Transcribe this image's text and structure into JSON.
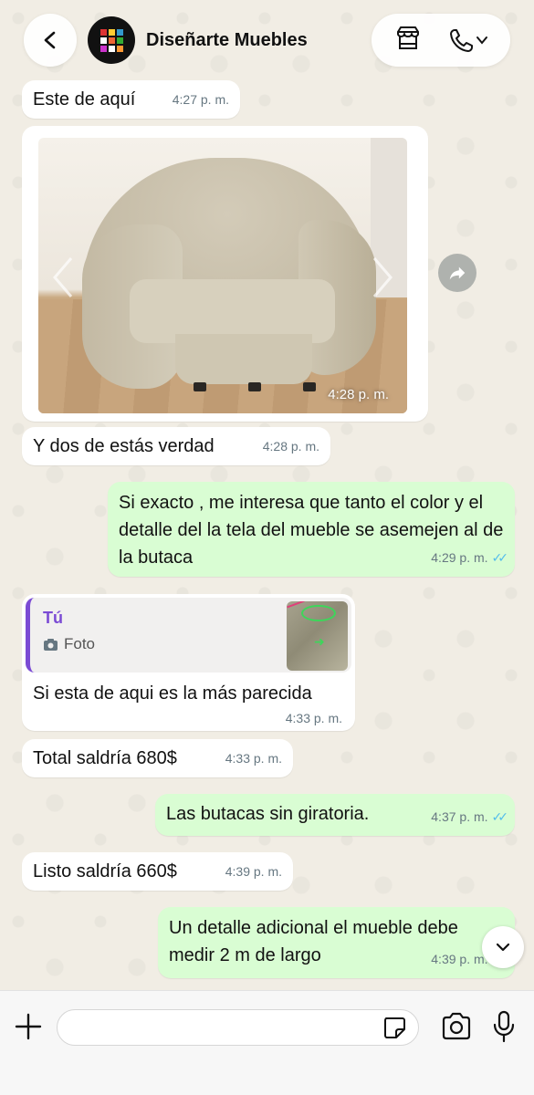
{
  "header": {
    "contact_name": "Diseñarte Muebles"
  },
  "messages": [
    {
      "direction": "in",
      "text": "Este de aquí",
      "time": "4:27 p. m."
    },
    {
      "direction": "in",
      "type": "image",
      "time": "4:28 p. m."
    },
    {
      "direction": "in",
      "text": "Y dos de estás verdad",
      "time": "4:28 p. m."
    },
    {
      "direction": "out",
      "text": "Si exacto ,  me interesa que  tanto el color y el detalle del la tela del mueble se asemejen al de la butaca",
      "time": "4:29 p. m.",
      "read": true
    },
    {
      "direction": "in",
      "type": "reply",
      "quote_author": "Tú",
      "quote_type": "Foto",
      "text": "Si esta de aqui es la más parecida",
      "time": "4:33 p. m."
    },
    {
      "direction": "in",
      "text": "Total saldría 680$",
      "time": "4:33 p. m."
    },
    {
      "direction": "out",
      "text": "Las butacas sin giratoria.",
      "time": "4:37 p. m.",
      "read": true
    },
    {
      "direction": "in",
      "text": "Listo saldría 660$",
      "time": "4:39 p. m."
    },
    {
      "direction": "out",
      "text": "Un detalle adicional el mueble debe medir 2 m de largo",
      "time": "4:39 p. m.",
      "read": true
    }
  ],
  "input": {
    "placeholder": ""
  },
  "colors": {
    "incoming_bubble": "#ffffff",
    "outgoing_bubble": "#d9fdd3",
    "read_ticks": "#53bdeb",
    "quote_accent": "#7b4bd4"
  },
  "icons": [
    "back-icon",
    "store-icon",
    "phone-icon",
    "chevron-down-icon",
    "forward-icon",
    "camera-icon",
    "plus-icon",
    "sticker-icon",
    "mic-icon"
  ]
}
